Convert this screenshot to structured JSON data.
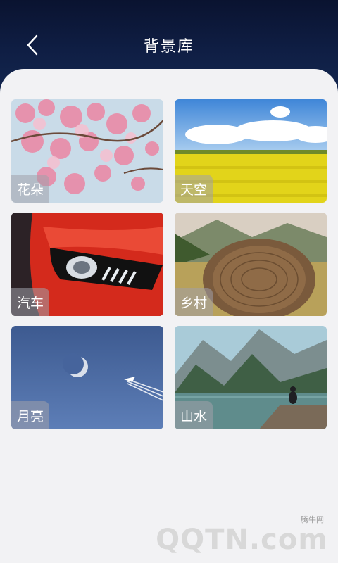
{
  "header": {
    "title": "背景库",
    "back_icon": "chevron-left-icon"
  },
  "backgrounds": [
    {
      "label": "花朵"
    },
    {
      "label": "天空"
    },
    {
      "label": "汽车"
    },
    {
      "label": "乡村"
    },
    {
      "label": "月亮"
    },
    {
      "label": "山水"
    }
  ],
  "watermark": {
    "brand": "QQTN.com",
    "tag": "腾牛网"
  }
}
